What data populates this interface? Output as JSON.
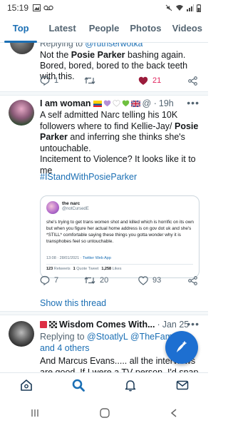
{
  "status_bar": {
    "time": "15:19"
  },
  "tabs": [
    {
      "label": "Top",
      "active": true
    },
    {
      "label": "Latest",
      "active": false
    },
    {
      "label": "People",
      "active": false
    },
    {
      "label": "Photos",
      "active": false
    },
    {
      "label": "Videos",
      "active": false
    }
  ],
  "tweet_partial": {
    "replying_prefix": "Replying to",
    "replying_handle": "@ruthserwotka",
    "text_before": "Not the ",
    "text_bold": "Posie Parker",
    "text_after": " bashing again. Bored, bored, bored to the back teeth with this.",
    "replies": "1",
    "retweets": "",
    "likes": "21"
  },
  "tweet_main": {
    "name": "I am woman",
    "time": "19h",
    "line1": "A self admitted Narc telling his 10K followers where to find Kellie-Jay/ ",
    "bold1": "Posie Parker",
    "line2": " and inferring she thinks she's untouchable.",
    "line3": "Incitement to Violence? It looks like it to me",
    "hashtag": "#IStandWithPosieParker",
    "quote": {
      "name": "the narc",
      "handle": "@notCursedE",
      "text": "she's trying to get trans women shot and killed which is horrific on its own but when you figure her actual home address is on gov dot uk and she's *STILL* comfortable saying these things you gotta wonder why it is transphobes feel so untouchable.",
      "time": "13:08 · 28/01/2021 · ",
      "client": "Twitter Web App",
      "retweets_count": "123",
      "retweets_label": "Retweets",
      "quote_count": "1",
      "quote_label": "Quote Tweet",
      "likes_count": "1,258",
      "likes_label": "Likes"
    },
    "replies": "7",
    "retweets": "20",
    "likes": "93",
    "show_thread": "Show this thread"
  },
  "tweet_third": {
    "name": "Wisdom Comes With...",
    "time": "Jan 25",
    "replying_prefix": "Replying to",
    "replying_handles": "@StoatlyL @TheFamour",
    "replying_others": "and 4 others",
    "text": "And Marcus Evans..... all the interviews are good. If I were a TV person, I'd snap them"
  },
  "colors": {
    "accent": "#1b6fb4",
    "like": "#e0245e",
    "fab": "#1d6fd1"
  },
  "icons": [
    "reply-icon",
    "retweet-icon",
    "heart-icon",
    "share-icon",
    "home-icon",
    "search-icon",
    "bell-icon",
    "mail-icon",
    "compose-icon"
  ]
}
